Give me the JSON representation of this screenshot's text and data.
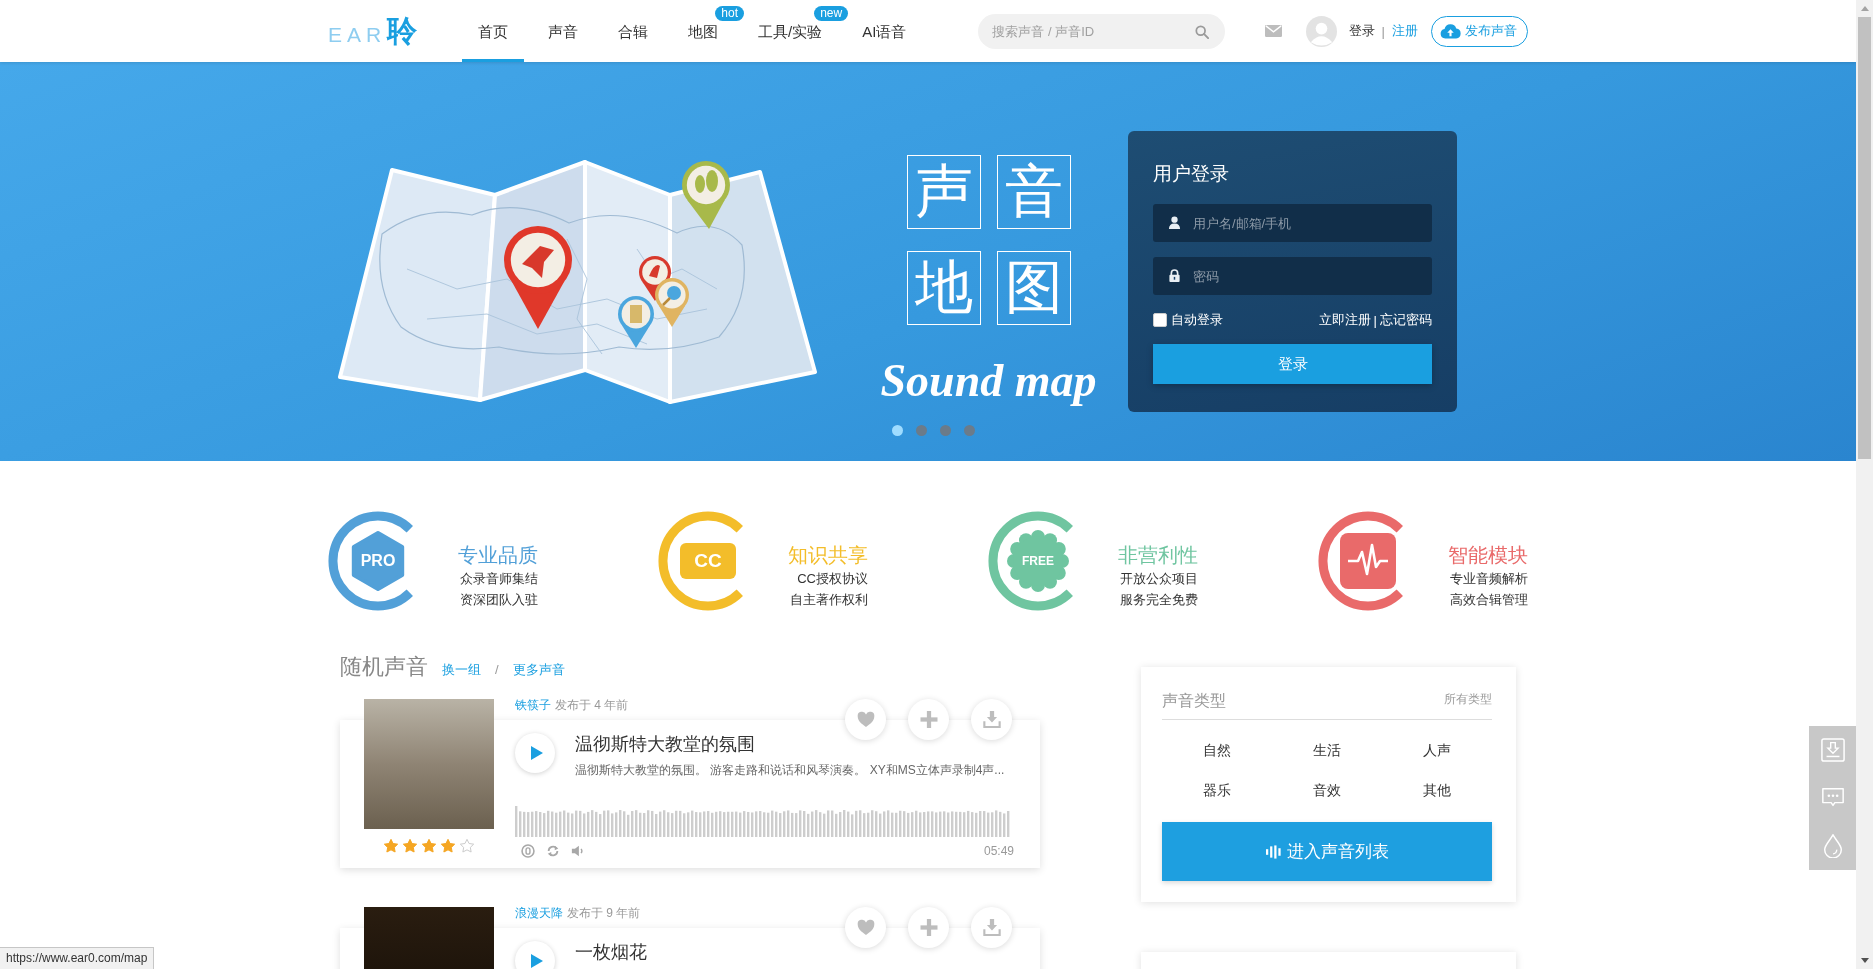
{
  "header": {
    "logo": {
      "latin": "EAR",
      "cjk": "聆"
    },
    "nav": [
      {
        "label": "首页",
        "selected": true
      },
      {
        "label": "声音",
        "selected": false
      },
      {
        "label": "合辑",
        "selected": false
      },
      {
        "label": "地图",
        "selected": false,
        "badge": "hot"
      },
      {
        "label": "工具/实验",
        "selected": false,
        "badge": "new"
      },
      {
        "label": "AI语音",
        "selected": false
      }
    ],
    "search": {
      "placeholder": "搜索声音 / 声音ID"
    },
    "login_link": "登录",
    "separator": "|",
    "register_link": "注册",
    "upload_button": "发布声音"
  },
  "banner": {
    "title_chars": [
      "声",
      "音",
      "地",
      "图"
    ],
    "subtitle": "Sound map",
    "login_panel": {
      "title": "用户登录",
      "username": {
        "placeholder": "用户名/邮箱/手机"
      },
      "password": {
        "placeholder": "密码"
      },
      "auto_login": {
        "label": "自动登录",
        "checked": false
      },
      "register_link": "立即注册",
      "separator": "|",
      "forgot_link": "忘记密码",
      "submit": "登录"
    },
    "dots": [
      {
        "selected": true
      },
      {
        "selected": false
      },
      {
        "selected": false
      },
      {
        "selected": false
      }
    ]
  },
  "features": [
    {
      "kind": "hexagon",
      "badge": "PRO",
      "title": "专业品质",
      "lines": [
        "众录音师集结",
        "资深团队入驻"
      ],
      "color": "#52a0d8"
    },
    {
      "kind": "rounded_square",
      "badge": "CC",
      "title": "知识共享",
      "lines": [
        "CC授权协议",
        "自主著作权利"
      ],
      "color": "#f3bd2a"
    },
    {
      "kind": "flower",
      "badge": "FREE",
      "title": "非营利性",
      "lines": [
        "开放公众项目",
        "服务完全免费"
      ],
      "color": "#6fc5a0"
    },
    {
      "kind": "waveform",
      "title": "智能模块",
      "lines": [
        "专业音频解析",
        "高效合辑管理"
      ],
      "color": "#e96a6a"
    }
  ],
  "random_sounds": {
    "title": "随机声音",
    "refresh_link": "换一组",
    "separator": "/",
    "more_link": "更多声音",
    "items": [
      {
        "author": "铁筷子",
        "posted": "发布于 4 年前",
        "title": "温彻斯特大教堂的氛围",
        "description": "温彻斯特大教堂的氛围。 游客走路和说话和风琴演奏。 XY和MS立体声录制4声...",
        "stars": 4,
        "duration": "05:49"
      },
      {
        "author": "浪漫天降",
        "posted": "发布于 9 年前",
        "title": "一枚烟花"
      }
    ]
  },
  "sound_types": {
    "title": "声音类型",
    "all_link": "所有类型",
    "types": [
      "自然",
      "生活",
      "人声",
      "器乐",
      "音效",
      "其他"
    ],
    "button": "进入声音列表"
  },
  "status_bar": {
    "url": "https://www.ear0.com/map"
  }
}
